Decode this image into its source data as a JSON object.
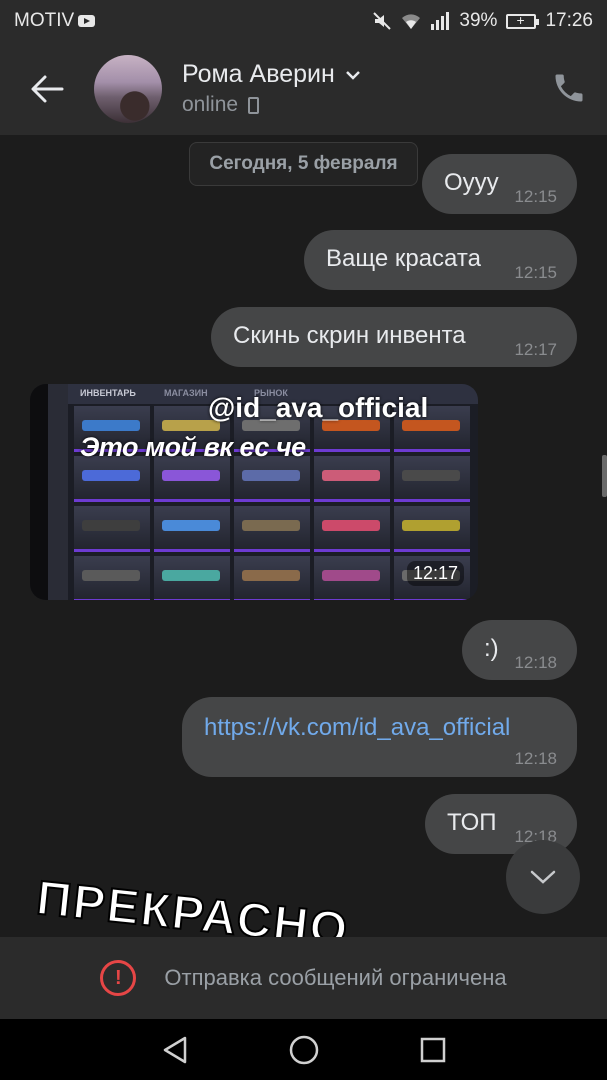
{
  "status_bar": {
    "carrier": "MOTIV",
    "battery": "39%",
    "time": "17:26"
  },
  "header": {
    "name": "Рома Аверин",
    "status": "online"
  },
  "chat": {
    "date": "Сегодня, 5 февраля",
    "messages": [
      {
        "text": "Оууу",
        "time": "12:15"
      },
      {
        "text": "Ваще красата",
        "time": "12:15"
      },
      {
        "text": "Скинь скрин инвента",
        "time": "12:17"
      },
      {
        "text": ":)",
        "time": "12:18"
      },
      {
        "text": "https://vk.com/id_ava_official",
        "time": "12:18"
      },
      {
        "text": "ТОП",
        "time": "12:18"
      }
    ],
    "photo": {
      "time": "12:17",
      "watermark_top": "@id_ava_official",
      "watermark_caption": "Это мой вк ес че",
      "tabs": [
        "ИНВЕНТАРЬ",
        "МАГАЗИН",
        "РЫНОК"
      ]
    },
    "sticker_text": "ПРЕКРАСНО"
  },
  "footer": {
    "notice": "Отправка сообщений ограничена"
  },
  "colors": {
    "background": "#1c1c1c",
    "bar": "#2b2b2b",
    "bubble": "#454647",
    "link": "#71aaeb",
    "warning": "#e64646"
  },
  "icons": [
    "back-arrow-icon",
    "chevron-down-icon",
    "phone-icon",
    "mobile-icon",
    "chevron-down-icon",
    "error-icon",
    "nav-back-icon",
    "nav-home-icon",
    "nav-recents-icon"
  ]
}
